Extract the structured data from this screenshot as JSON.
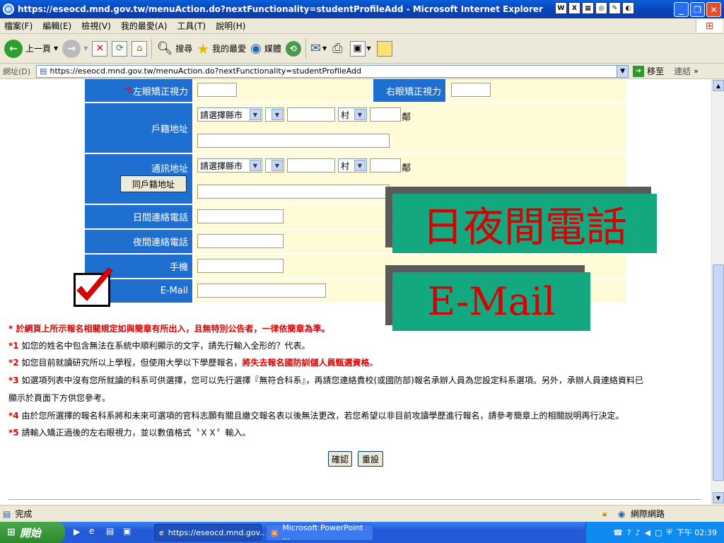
{
  "window": {
    "title": "https://eseocd.mnd.gov.tw/menuAction.do?nextFunctionality=studentProfileAdd - Microsoft Internet Explorer"
  },
  "menu": [
    "檔案(F)",
    "編輯(E)",
    "檢視(V)",
    "我的最愛(A)",
    "工具(T)",
    "說明(H)"
  ],
  "toolbar": {
    "back": "上一頁",
    "search": "搜尋",
    "favorites": "我的最愛",
    "media": "媒體"
  },
  "address": {
    "label": "網址(D)",
    "url": "https://eseocd.mnd.gov.tw/menuAction.do?nextFunctionality=studentProfileAdd",
    "go": "移至",
    "links": "連結"
  },
  "form": {
    "left_vision_marker": "*5",
    "left_vision_label": "左眼矯正視力",
    "right_vision_label": "右眼矯正視力",
    "household_label": "戶籍地址",
    "mailing_label": "通訊地址",
    "same_as_household": "同戶籍地址",
    "city_placeholder": "請選擇縣市",
    "village": "村",
    "neighborhood": "鄰",
    "day_phone_label": "日間連絡電話",
    "night_phone_label": "夜間連絡電話",
    "mobile_label": "手機",
    "email_label": "E-Mail"
  },
  "overlays": {
    "phone_banner": "日夜間電話",
    "email_banner": "E-Mail"
  },
  "notes": {
    "star": "*",
    "star_text": "於網頁上所示報名相關規定如與簡章有所出入，且無特別公告者，一律依簡章為準。",
    "n1": "*1",
    "t1": "如您的姓名中包含無法在系統中順利顯示的文字，請先行輸入全形的？代表。",
    "n2": "*2",
    "t2a": "如您目前就讀研究所以上學程，但使用大學以下學歷報名，",
    "t2b": "將失去報名國防訓儲人員甄選資格",
    "t2c": "。",
    "n3": "*3",
    "t3a": "如選項列表中沒有您所就讀的科系可供選擇，您可以先行選擇『無符合科系』，再請您連絡貴校(或國防部)報名承辦人員為您設定科系選項。另外，承辦人員連絡資料已",
    "t3b": "顯示於頁面下方供您參考。",
    "n4": "*4",
    "t4": "由於您所選擇的報名科系將和未來可選項的官科志願有關且繳交報名表以後無法更改，若您希望以非目前攻讀學歷進行報名，請參考簡章上的相關說明再行決定。",
    "n5": "*5",
    "t5": "請輸入矯正過後的左右眼視力，並以數值格式〝ＸＸ〞輸入。"
  },
  "buttons": {
    "confirm": "確認",
    "reset": "重設"
  },
  "status": {
    "done": "完成",
    "zone": "網際網路"
  },
  "taskbar": {
    "start": "開始",
    "task_ie": "https://eseocd.mnd.gov...",
    "task_ppt": "Microsoft PowerPoint ...",
    "clock": "下午 02:39"
  },
  "colors": {
    "label_blue": "#1f6fd0",
    "field_yellow": "#fffbd6",
    "banner_green": "#13a880",
    "banner_red": "#d80000"
  }
}
